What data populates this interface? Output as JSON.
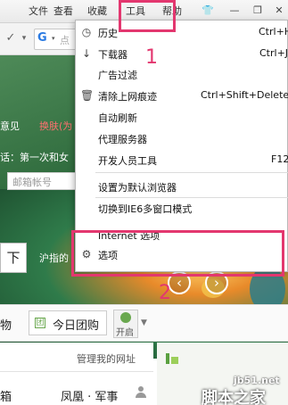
{
  "menubar": {
    "items": [
      "文件",
      "查看",
      "收藏",
      "工具",
      "帮助"
    ],
    "window_buttons": [
      "👕",
      "—",
      "❐",
      "✕"
    ]
  },
  "toolbar": {
    "search_placeholder": "点"
  },
  "page": {
    "feedback_link": "意见",
    "skin_link": "换肤(为",
    "notice_text": "话：第一次和女",
    "login_placeholder": "邮箱帐号",
    "download_button": "下",
    "shanghai_text": "沪指的",
    "tab_wu": "物",
    "tab_group_buy": "今日团购",
    "toggle_label": "开启",
    "manage_link": "管理我的网址",
    "site_xiang": "箱",
    "site_fenghuang": "凤凰 · 军事"
  },
  "dropdown": {
    "items": [
      {
        "label": "历史",
        "shortcut": "Ctrl+H",
        "icon": "history-icon",
        "glyph": "◷"
      },
      {
        "label": "下载器",
        "shortcut": "Ctrl+J",
        "icon": "download-icon",
        "glyph": "↓"
      },
      {
        "label": "广告过滤",
        "shortcut": "",
        "icon": "",
        "glyph": ""
      },
      {
        "label": "清除上网痕迹",
        "shortcut": "Ctrl+Shift+Delete",
        "icon": "trash-icon",
        "glyph": "🗑"
      },
      {
        "label": "自动刷新",
        "shortcut": "",
        "icon": "",
        "glyph": ""
      },
      {
        "label": "代理服务器",
        "shortcut": "",
        "icon": "",
        "glyph": ""
      },
      {
        "label": "开发人员工具",
        "shortcut": "F12",
        "icon": "",
        "glyph": ""
      },
      {
        "label": "设置为默认浏览器",
        "shortcut": "",
        "icon": "",
        "glyph": ""
      },
      {
        "label": "切换到IE6多窗口模式",
        "shortcut": "",
        "icon": "",
        "glyph": ""
      },
      {
        "label": "Internet 选项",
        "shortcut": "",
        "icon": "",
        "glyph": ""
      },
      {
        "label": "选项",
        "shortcut": "",
        "icon": "settings-gear-icon",
        "glyph": "⚙"
      }
    ]
  },
  "annotations": {
    "step1": "1",
    "step2": "2"
  },
  "watermark": {
    "domain": "jb51.net",
    "name": "脚本之家"
  },
  "colors": {
    "highlight": "#e3376f",
    "page_green": "#2f6b3d"
  }
}
